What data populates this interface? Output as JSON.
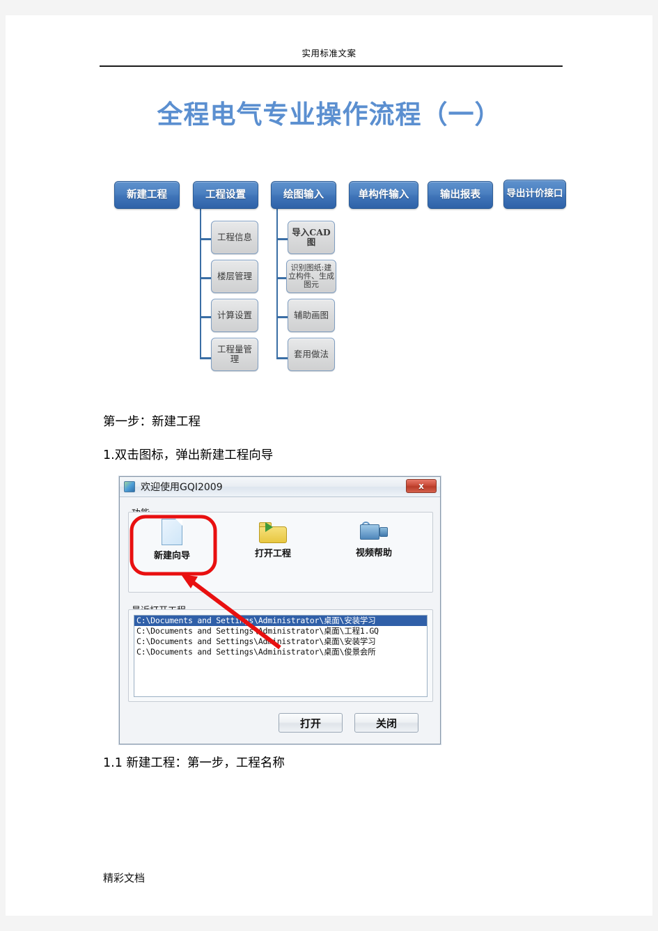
{
  "document": {
    "header_text": "实用标准文案",
    "title": "全程电气专业操作流程（一）",
    "footer_text": "精彩文档",
    "title_color": "#5b8fd0"
  },
  "flowchart": {
    "top_row": [
      {
        "label": "新建工程"
      },
      {
        "label": "工程设置"
      },
      {
        "label": "绘图输入"
      },
      {
        "label": "单构件输入"
      },
      {
        "label": "输出报表"
      },
      {
        "label": "导出计价接口"
      }
    ],
    "branch_engineering_settings": [
      {
        "label": "工程信息"
      },
      {
        "label": "楼层管理"
      },
      {
        "label": "计算设置"
      },
      {
        "label": "工程量管理"
      }
    ],
    "branch_drawing_input": [
      {
        "label": "导入CAD图"
      },
      {
        "label": "识别图纸:建立构件、生成图元"
      },
      {
        "label": "辅助画图"
      },
      {
        "label": "套用做法"
      }
    ],
    "colors": {
      "primary": "#3f74b8",
      "secondary": "#d9dadb",
      "connector": "#3a6ea5"
    }
  },
  "body": {
    "step_heading": "第一步：新建工程",
    "step_1": "1.双击图标，弹出新建工程向导",
    "step_1_1": "1.1 新建工程：第一步，工程名称"
  },
  "dialog": {
    "title": "欢迎使用GQI2009",
    "close_label": "x",
    "function_group": {
      "label": "功能",
      "items": [
        {
          "label": "新建向导",
          "icon": "new-document-icon"
        },
        {
          "label": "打开工程",
          "icon": "open-folder-icon"
        },
        {
          "label": "视频帮助",
          "icon": "video-camera-icon"
        }
      ]
    },
    "recent_group": {
      "label": "最近打开工程",
      "items": [
        {
          "path": "C:\\Documents and Settings\\Administrator\\桌面\\安装学习",
          "selected": true
        },
        {
          "path": "C:\\Documents and Settings\\Administrator\\桌面\\工程1.GQ",
          "selected": false
        },
        {
          "path": "C:\\Documents and Settings\\Administrator\\桌面\\安装学习",
          "selected": false
        },
        {
          "path": "C:\\Documents and Settings\\Administrator\\桌面\\俊景会所",
          "selected": false
        }
      ]
    },
    "buttons": {
      "open": "打开",
      "close": "关闭"
    },
    "annotation": {
      "highlight_target": "新建向导",
      "color": "#e81010"
    }
  }
}
